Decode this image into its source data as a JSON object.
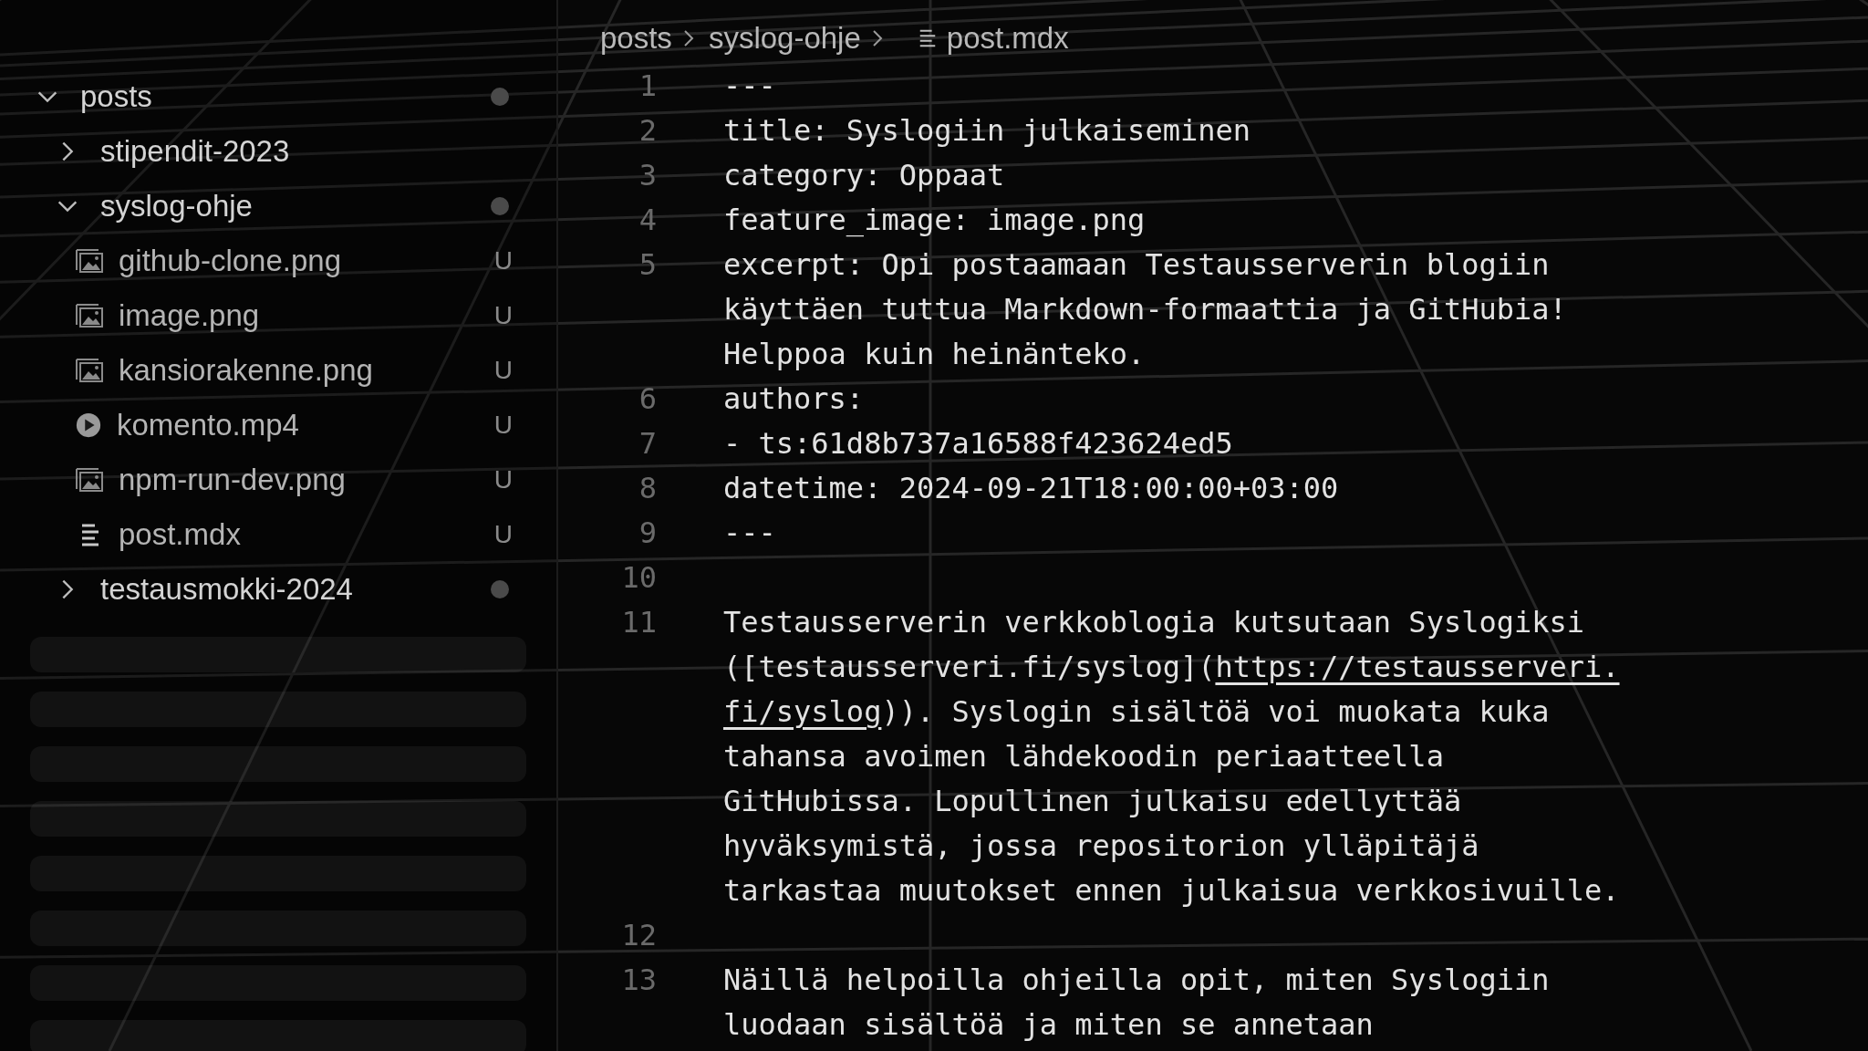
{
  "sidebar": {
    "tree": [
      {
        "kind": "folder",
        "name": "posts",
        "expanded": true,
        "modified": true,
        "children": [
          {
            "kind": "folder",
            "name": "stipendit-2023",
            "expanded": false,
            "modified": false
          },
          {
            "kind": "folder",
            "name": "syslog-ohje",
            "expanded": true,
            "modified": true,
            "children": [
              {
                "kind": "image",
                "name": "github-clone.png",
                "badge": "U"
              },
              {
                "kind": "image",
                "name": "image.png",
                "badge": "U"
              },
              {
                "kind": "image",
                "name": "kansiorakenne.png",
                "badge": "U"
              },
              {
                "kind": "video",
                "name": "komento.mp4",
                "badge": "U"
              },
              {
                "kind": "image",
                "name": "npm-run-dev.png",
                "badge": "U"
              },
              {
                "kind": "text",
                "name": "post.mdx",
                "badge": "U"
              }
            ]
          },
          {
            "kind": "folder",
            "name": "testausmokki-2024",
            "expanded": false,
            "modified": true
          }
        ]
      }
    ]
  },
  "breadcrumb": [
    "posts",
    "syslog-ohje",
    "post.mdx"
  ],
  "editor": {
    "lines": [
      {
        "number": "1",
        "rows": [
          "---"
        ]
      },
      {
        "number": "2",
        "rows": [
          "title: Syslogiin julkaiseminen"
        ]
      },
      {
        "number": "3",
        "rows": [
          "category: Oppaat"
        ]
      },
      {
        "number": "4",
        "rows": [
          "feature_image: image.png"
        ]
      },
      {
        "number": "5",
        "rows": [
          "excerpt: Opi postaamaan Testausserverin blogiin",
          "käyttäen tuttua Markdown-formaattia ja GitHubia!",
          "Helppoa kuin heinänteko."
        ]
      },
      {
        "number": "6",
        "rows": [
          "authors:"
        ]
      },
      {
        "number": "7",
        "rows": [
          "- ts:61d8b737a16588f423624ed5"
        ]
      },
      {
        "number": "8",
        "rows": [
          "datetime: 2024-09-21T18:00:00+03:00"
        ]
      },
      {
        "number": "9",
        "rows": [
          "---"
        ]
      },
      {
        "number": "10"
      },
      {
        "number": "11",
        "rows": [
          "Testausserverin verkkoblogia kutsutaan Syslogiksi",
          {
            "before": "([testausserveri.fi/syslog](",
            "link": "https://testausserveri."
          },
          {
            "link": "fi/syslog",
            "after": ")). Syslogin sisältöä voi muokata kuka"
          },
          "tahansa avoimen lähdekoodin periaatteella",
          "GitHubissa. Lopullinen julkaisu edellyttää",
          "hyväksymistä, jossa repositorion ylläpitäjä",
          "tarkastaa muutokset ennen julkaisua verkkosivuille."
        ]
      },
      {
        "number": "12"
      },
      {
        "number": "13",
        "rows": [
          "Näillä helpoilla ohjeilla opit, miten Syslogiin",
          "luodaan sisältöä ja miten se annetaan"
        ]
      }
    ]
  }
}
